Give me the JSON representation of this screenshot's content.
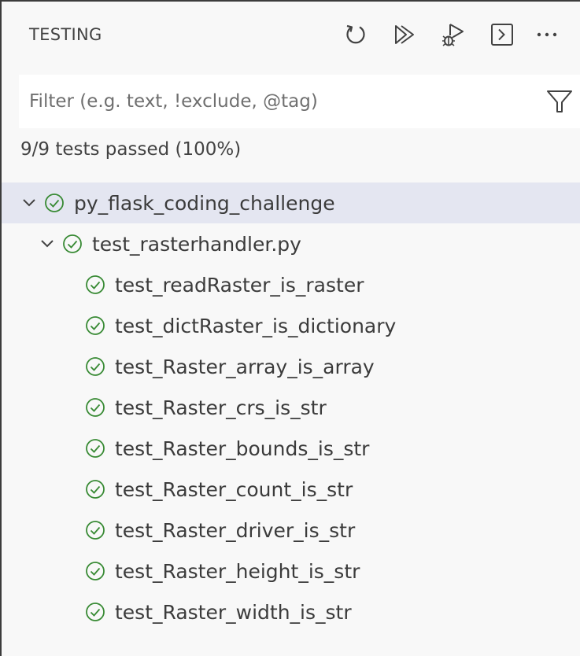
{
  "header": {
    "title": "TESTING",
    "actions": [
      {
        "icon": "refresh-icon",
        "name": "refresh-tests-button"
      },
      {
        "icon": "run-all-icon",
        "name": "run-tests-button"
      },
      {
        "icon": "debug-icon",
        "name": "debug-tests-button"
      },
      {
        "icon": "terminal-icon",
        "name": "show-output-button"
      },
      {
        "icon": "more-icon",
        "name": "more-actions-button"
      }
    ]
  },
  "filter": {
    "placeholder": "Filter (e.g. text, !exclude, @tag)",
    "value": ""
  },
  "summary": "9/9 tests passed (100%)",
  "colors": {
    "pass": "#388a34",
    "selected_row": "#e4e6f1",
    "icon": "#424242"
  },
  "tree": {
    "root": {
      "label": "py_flask_coding_challenge",
      "status": "passed",
      "expanded": true
    },
    "file": {
      "label": "test_rasterhandler.py",
      "status": "passed",
      "expanded": true
    },
    "tests": [
      {
        "label": "test_readRaster_is_raster",
        "status": "passed"
      },
      {
        "label": "test_dictRaster_is_dictionary",
        "status": "passed"
      },
      {
        "label": "test_Raster_array_is_array",
        "status": "passed"
      },
      {
        "label": "test_Raster_crs_is_str",
        "status": "passed"
      },
      {
        "label": "test_Raster_bounds_is_str",
        "status": "passed"
      },
      {
        "label": "test_Raster_count_is_str",
        "status": "passed"
      },
      {
        "label": "test_Raster_driver_is_str",
        "status": "passed"
      },
      {
        "label": "test_Raster_height_is_str",
        "status": "passed"
      },
      {
        "label": "test_Raster_width_is_str",
        "status": "passed"
      }
    ]
  }
}
